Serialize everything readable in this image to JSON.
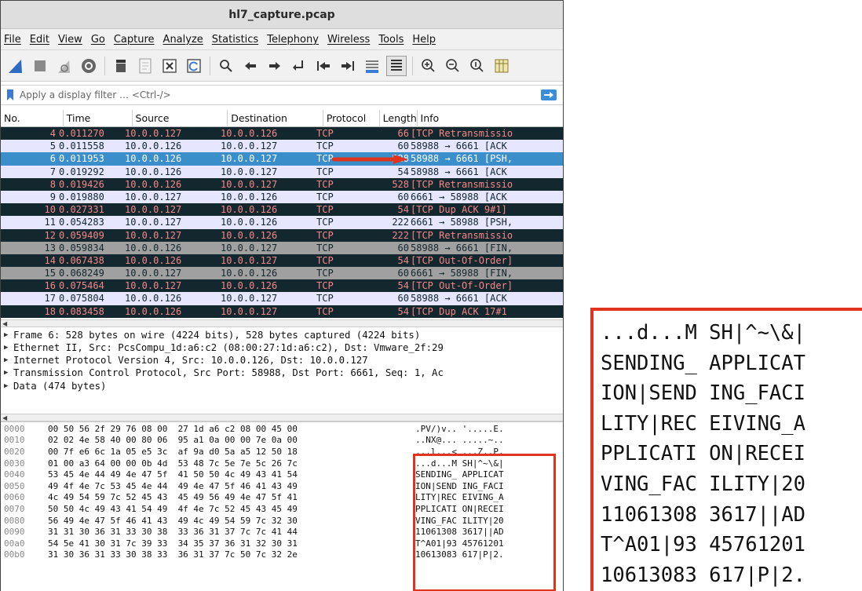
{
  "window": {
    "title": "hl7_capture.pcap"
  },
  "menu": [
    "File",
    "Edit",
    "View",
    "Go",
    "Capture",
    "Analyze",
    "Statistics",
    "Telephony",
    "Wireless",
    "Tools",
    "Help"
  ],
  "toolbar": {
    "icons": [
      "shark-fin-start-icon",
      "stop-capture-icon",
      "restart-capture-icon",
      "capture-options-icon",
      "open-file-icon",
      "save-file-icon",
      "close-file-icon",
      "reload-file-icon",
      "find-packet-icon",
      "go-back-icon",
      "go-forward-icon",
      "go-to-packet-icon",
      "first-packet-icon",
      "last-packet-icon",
      "autoscroll-icon",
      "colorize-icon",
      "zoom-in-icon",
      "zoom-out-icon",
      "normal-size-icon",
      "resize-columns-icon"
    ]
  },
  "filter": {
    "placeholder": "Apply a display filter … <Ctrl-/>"
  },
  "columns": {
    "no": "No.",
    "time": "Time",
    "source": "Source",
    "destination": "Destination",
    "protocol": "Protocol",
    "length": "Length",
    "info": "Info"
  },
  "packets": [
    {
      "no": "4",
      "time": "0.011270",
      "src": "10.0.0.127",
      "dst": "10.0.0.126",
      "proto": "TCP",
      "len": "66",
      "info": "[TCP Retransmissio",
      "style": "dark"
    },
    {
      "no": "5",
      "time": "0.011558",
      "src": "10.0.0.126",
      "dst": "10.0.0.127",
      "proto": "TCP",
      "len": "60",
      "info": "58988 → 6661 [ACK",
      "style": "light"
    },
    {
      "no": "6",
      "time": "0.011953",
      "src": "10.0.0.126",
      "dst": "10.0.0.127",
      "proto": "TCP",
      "len": "528",
      "info": "58988 → 6661 [PSH,",
      "style": "sel"
    },
    {
      "no": "7",
      "time": "0.019292",
      "src": "10.0.0.126",
      "dst": "10.0.0.127",
      "proto": "TCP",
      "len": "54",
      "info": "58988 → 6661 [ACK",
      "style": "light"
    },
    {
      "no": "8",
      "time": "0.019426",
      "src": "10.0.0.126",
      "dst": "10.0.0.127",
      "proto": "TCP",
      "len": "528",
      "info": "[TCP Retransmissio",
      "style": "dark"
    },
    {
      "no": "9",
      "time": "0.019880",
      "src": "10.0.0.127",
      "dst": "10.0.0.126",
      "proto": "TCP",
      "len": "60",
      "info": "6661 → 58988 [ACK",
      "style": "light"
    },
    {
      "no": "10",
      "time": "0.027331",
      "src": "10.0.0.127",
      "dst": "10.0.0.126",
      "proto": "TCP",
      "len": "54",
      "info": "[TCP Dup ACK 9#1]",
      "style": "dark"
    },
    {
      "no": "11",
      "time": "0.054283",
      "src": "10.0.0.127",
      "dst": "10.0.0.126",
      "proto": "TCP",
      "len": "222",
      "info": "6661 → 58988 [PSH,",
      "style": "light"
    },
    {
      "no": "12",
      "time": "0.059409",
      "src": "10.0.0.127",
      "dst": "10.0.0.126",
      "proto": "TCP",
      "len": "222",
      "info": "[TCP Retransmissio",
      "style": "dark"
    },
    {
      "no": "13",
      "time": "0.059834",
      "src": "10.0.0.126",
      "dst": "10.0.0.127",
      "proto": "TCP",
      "len": "60",
      "info": "58988 → 6661 [FIN,",
      "style": "gray"
    },
    {
      "no": "14",
      "time": "0.067438",
      "src": "10.0.0.126",
      "dst": "10.0.0.127",
      "proto": "TCP",
      "len": "54",
      "info": "[TCP Out-Of-Order]",
      "style": "dark"
    },
    {
      "no": "15",
      "time": "0.068249",
      "src": "10.0.0.127",
      "dst": "10.0.0.126",
      "proto": "TCP",
      "len": "60",
      "info": "6661 → 58988 [FIN,",
      "style": "gray"
    },
    {
      "no": "16",
      "time": "0.075464",
      "src": "10.0.0.127",
      "dst": "10.0.0.126",
      "proto": "TCP",
      "len": "54",
      "info": "[TCP Out-Of-Order]",
      "style": "dark"
    },
    {
      "no": "17",
      "time": "0.075804",
      "src": "10.0.0.126",
      "dst": "10.0.0.127",
      "proto": "TCP",
      "len": "60",
      "info": "58988 → 6661 [ACK",
      "style": "light"
    },
    {
      "no": "18",
      "time": "0.083458",
      "src": "10.0.0.126",
      "dst": "10.0.0.127",
      "proto": "TCP",
      "len": "54",
      "info": "[TCP Dup ACK 17#1",
      "style": "dark"
    }
  ],
  "details": [
    "Frame 6: 528 bytes on wire (4224 bits), 528 bytes captured (4224 bits)",
    "Ethernet II, Src: PcsCompu_1d:a6:c2 (08:00:27:1d:a6:c2), Dst: Vmware_2f:29",
    "Internet Protocol Version 4, Src: 10.0.0.126, Dst: 10.0.0.127",
    "Transmission Control Protocol, Src Port: 58988, Dst Port: 6661, Seq: 1, Ac",
    "Data (474 bytes)"
  ],
  "hex": [
    {
      "off": "0000",
      "bytes": "00 50 56 2f 29 76 08 00  27 1d a6 c2 08 00 45 00",
      "ascii": ".PV/)v.. '.....E."
    },
    {
      "off": "0010",
      "bytes": "02 02 4e 58 40 00 80 06  95 a1 0a 00 00 7e 0a 00",
      "ascii": "..NX@... .....~.."
    },
    {
      "off": "0020",
      "bytes": "00 7f e6 6c 1a 05 e5 3c  af 9a d0 5a a5 12 50 18",
      "ascii": "...l...< ...Z..P."
    },
    {
      "off": "0030",
      "bytes": "01 00 a3 64 00 00 0b 4d  53 48 7c 5e 7e 5c 26 7c",
      "ascii": "...d...M SH|^~\\&|"
    },
    {
      "off": "0040",
      "bytes": "53 45 4e 44 49 4e 47 5f  41 50 50 4c 49 43 41 54",
      "ascii": "SENDING_ APPLICAT"
    },
    {
      "off": "0050",
      "bytes": "49 4f 4e 7c 53 45 4e 44  49 4e 47 5f 46 41 43 49",
      "ascii": "ION|SEND ING_FACI"
    },
    {
      "off": "0060",
      "bytes": "4c 49 54 59 7c 52 45 43  45 49 56 49 4e 47 5f 41",
      "ascii": "LITY|REC EIVING_A"
    },
    {
      "off": "0070",
      "bytes": "50 50 4c 49 43 41 54 49  4f 4e 7c 52 45 43 45 49",
      "ascii": "PPLICATI ON|RECEI"
    },
    {
      "off": "0080",
      "bytes": "56 49 4e 47 5f 46 41 43  49 4c 49 54 59 7c 32 30",
      "ascii": "VING_FAC ILITY|20"
    },
    {
      "off": "0090",
      "bytes": "31 31 30 36 31 33 30 38  33 36 31 37 7c 7c 41 44",
      "ascii": "11061308 3617||AD"
    },
    {
      "off": "00a0",
      "bytes": "54 5e 41 30 31 7c 39 33  34 35 37 36 31 32 30 31",
      "ascii": "T^A01|93 45761201"
    },
    {
      "off": "00b0",
      "bytes": "31 30 36 31 33 30 38 33  36 31 37 7c 50 7c 32 2e",
      "ascii": "10613083 617|P|2."
    }
  ],
  "zoom": [
    "...d...M SH|^~\\&|",
    "SENDING_ APPLICAT",
    "ION|SEND ING_FACI",
    "LITY|REC EIVING_A",
    "PPLICATI ON|RECEI",
    "VING_FAC ILITY|20",
    "11061308 3617||AD",
    "T^A01|93 45761201",
    "10613083 617|P|2."
  ],
  "colors": {
    "highlight": "#e0341f",
    "selected_row": "#3a8ec9",
    "dark_row": "#12272e",
    "light_row": "#e7e6ff"
  }
}
